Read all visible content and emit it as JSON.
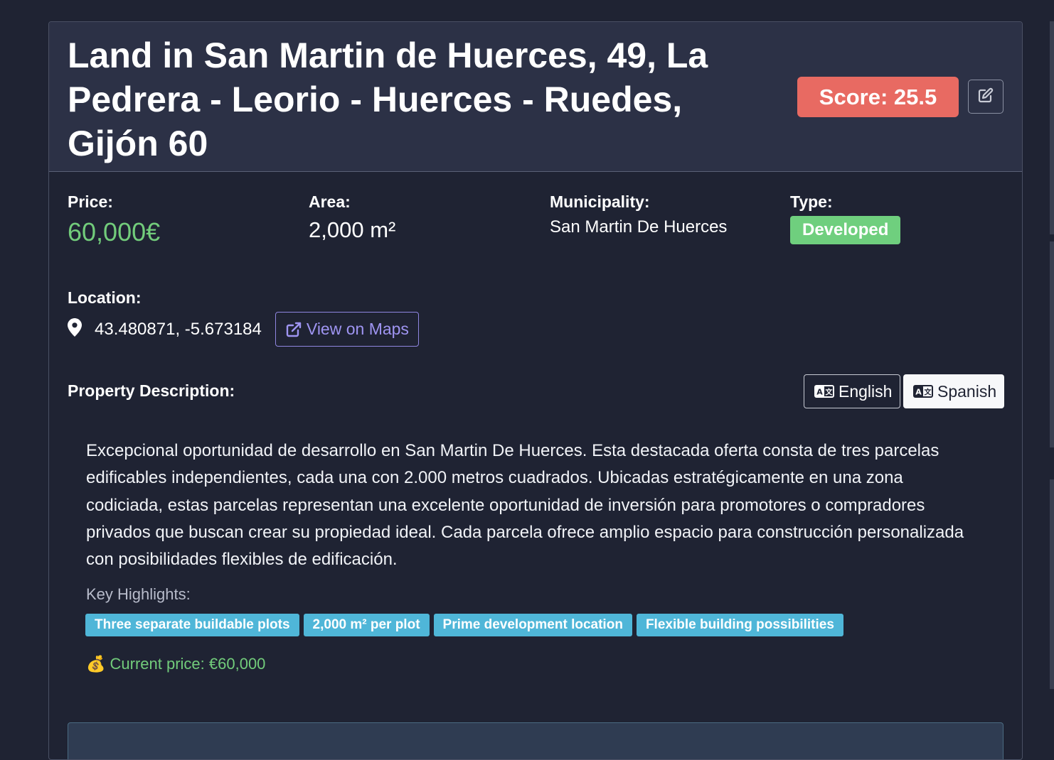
{
  "header": {
    "title": "Land in San Martin de Huerces, 49, La Pedrera - Leorio - Huerces - Ruedes, Gijón 60",
    "score_label": "Score: 25.5",
    "score_color": "#e86a62"
  },
  "details": {
    "price_label": "Price:",
    "price_value": "60,000€",
    "area_label": "Area:",
    "area_value": "2,000 m²",
    "municipality_label": "Municipality:",
    "municipality_value": "San Martin De Huerces",
    "type_label": "Type:",
    "type_value": "Developed"
  },
  "location": {
    "label": "Location:",
    "coordinates": "43.480871, -5.673184",
    "maps_button": "View on Maps"
  },
  "description": {
    "label": "Property Description:",
    "languages": [
      "English",
      "Spanish"
    ],
    "selected_language": "Spanish",
    "text": "Excepcional oportunidad de desarrollo en San Martin De Huerces. Esta destacada oferta consta de tres parcelas edificables independientes, cada una con 2.000 metros cuadrados. Ubicadas estratégicamente en una zona codiciada, estas parcelas representan una excelente oportunidad de inversión para promotores o compradores privados que buscan crear su propiedad ideal. Cada parcela ofrece amplio espacio para construcción personalizada con posibilidades flexibles de edificación.",
    "highlights_label": "Key Highlights:",
    "highlights": [
      "Three separate buildable plots",
      "2,000 m² per plot",
      "Prime development location",
      "Flexible building possibilities"
    ],
    "current_price": "💰 Current price: €60,000"
  },
  "icons": {
    "edit": "edit-icon",
    "location": "map-pin-icon",
    "external_link": "external-link-icon",
    "translate": "translate-icon"
  }
}
